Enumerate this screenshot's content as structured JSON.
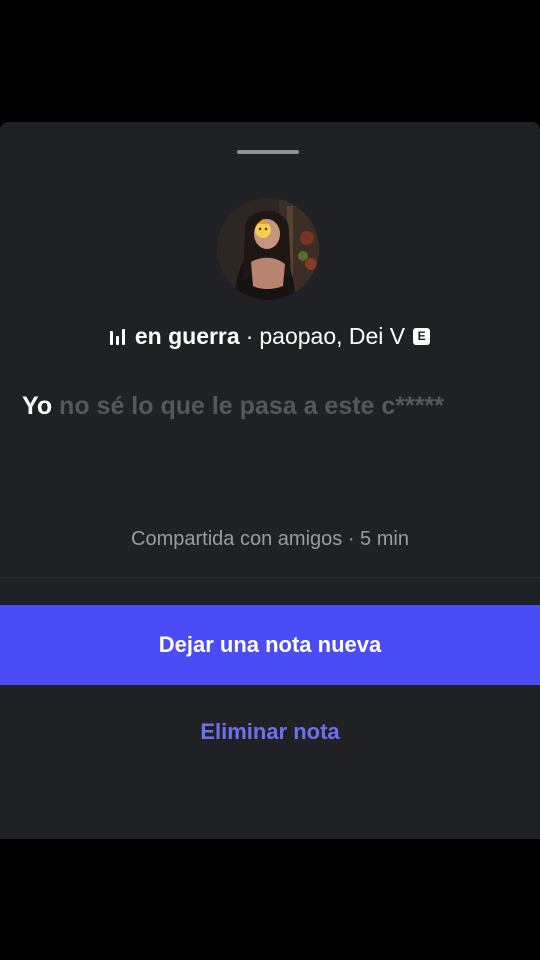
{
  "sheet": {
    "background": "#202124",
    "handle_icon": "drag-handle"
  },
  "note": {
    "avatar_icon": "profile-photo",
    "music": {
      "icon": "music-bars-icon",
      "song": "en guerra",
      "separator": "·",
      "artists": "paopao, Dei V",
      "explicit_badge": "E"
    },
    "lyric": {
      "active_word": "Yo",
      "remaining": "no sé lo que le pasa a este c*****"
    },
    "meta": "Compartida con amigos · 5 min"
  },
  "actions": {
    "primary_label": "Dejar una nota nueva",
    "primary_color": "#4a4cf6",
    "secondary_label": "Eliminar nota",
    "secondary_color": "#6b72f2"
  }
}
